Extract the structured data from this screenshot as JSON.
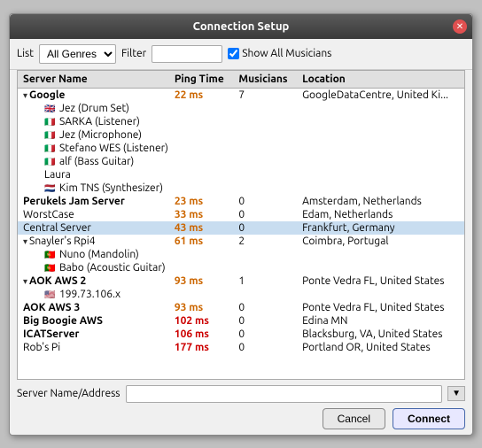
{
  "dialog": {
    "title": "Connection Setup",
    "close_label": "✕"
  },
  "toolbar": {
    "list_label": "List",
    "list_options": [
      "All Genres"
    ],
    "list_selected": "All Genres",
    "filter_label": "Filter",
    "filter_placeholder": "",
    "show_all_label": "Show All Musicians"
  },
  "table": {
    "headers": [
      "Server Name",
      "Ping Time",
      "Musicians",
      "Location"
    ],
    "rows": [
      {
        "type": "server-expand",
        "name": "Google",
        "ping": "22 ms",
        "musicians": "7",
        "location": "GoogleDataCentre, United Ki...",
        "bold": true
      },
      {
        "type": "musician",
        "flag": "gb",
        "name": "Jez  (Drum Set)",
        "ping": "",
        "musicians": "",
        "location": ""
      },
      {
        "type": "musician",
        "flag": "it",
        "name": "SARKA (Listener)",
        "ping": "",
        "musicians": "",
        "location": ""
      },
      {
        "type": "musician",
        "flag": "it",
        "name": "Jez  (Microphone)",
        "ping": "",
        "musicians": "",
        "location": ""
      },
      {
        "type": "musician",
        "flag": "it",
        "name": "Stefano WES (Listener)",
        "ping": "",
        "musicians": "",
        "location": ""
      },
      {
        "type": "musician",
        "flag": "it",
        "name": "alf (Bass Guitar)",
        "ping": "",
        "musicians": "",
        "location": ""
      },
      {
        "type": "musician",
        "flag": "",
        "name": "Laura",
        "ping": "",
        "musicians": "",
        "location": ""
      },
      {
        "type": "musician",
        "flag": "nl",
        "name": "Kim   TNS (Synthesizer)",
        "ping": "",
        "musicians": "",
        "location": ""
      },
      {
        "type": "server",
        "name": "Perukels Jam Server",
        "ping": "23 ms",
        "musicians": "0",
        "location": "Amsterdam, Netherlands",
        "bold": true
      },
      {
        "type": "server",
        "name": "WorstCase",
        "ping": "33 ms",
        "musicians": "0",
        "location": "Edam, Netherlands",
        "bold": false
      },
      {
        "type": "server",
        "name": "Central Server",
        "ping": "43 ms",
        "musicians": "0",
        "location": "Frankfurt, Germany",
        "bold": false,
        "selected": true
      },
      {
        "type": "server-expand",
        "name": "Snayler's Rpi4",
        "ping": "61 ms",
        "musicians": "2",
        "location": "Coimbra, Portugal",
        "bold": false
      },
      {
        "type": "musician",
        "flag": "pt",
        "name": "Nuno (Mandolin)",
        "ping": "",
        "musicians": "",
        "location": ""
      },
      {
        "type": "musician",
        "flag": "pt",
        "name": "Babo (Acoustic Guitar)",
        "ping": "",
        "musicians": "",
        "location": ""
      },
      {
        "type": "server-expand",
        "name": "AOK AWS 2",
        "ping": "93 ms",
        "musicians": "1",
        "location": "Ponte Vedra FL, United States",
        "bold": true
      },
      {
        "type": "musician",
        "flag": "us",
        "name": "199.73.106.x",
        "ping": "",
        "musicians": "",
        "location": ""
      },
      {
        "type": "server",
        "name": "AOK AWS 3",
        "ping": "93 ms",
        "musicians": "0",
        "location": "Ponte Vedra FL, United States",
        "bold": true
      },
      {
        "type": "server",
        "name": "Big Boogie AWS",
        "ping": "102 ms",
        "musicians": "0",
        "location": "Edina MN",
        "bold": true
      },
      {
        "type": "server",
        "name": "ICATServer",
        "ping": "106 ms",
        "musicians": "0",
        "location": "Blacksburg, VA, United States",
        "bold": true
      },
      {
        "type": "server",
        "name": "Rob's Pi",
        "ping": "177 ms",
        "musicians": "0",
        "location": "Portland OR, United States",
        "bold": false
      }
    ]
  },
  "bottom": {
    "addr_label": "Server Name/Address",
    "addr_value": "",
    "addr_placeholder": "",
    "cancel_label": "Cancel",
    "connect_label": "Connect"
  },
  "flags": {
    "gb": "🇬🇧",
    "it": "🇮🇹",
    "nl": "🇳🇱",
    "pt": "🇵🇹",
    "us": "🇺🇸"
  }
}
